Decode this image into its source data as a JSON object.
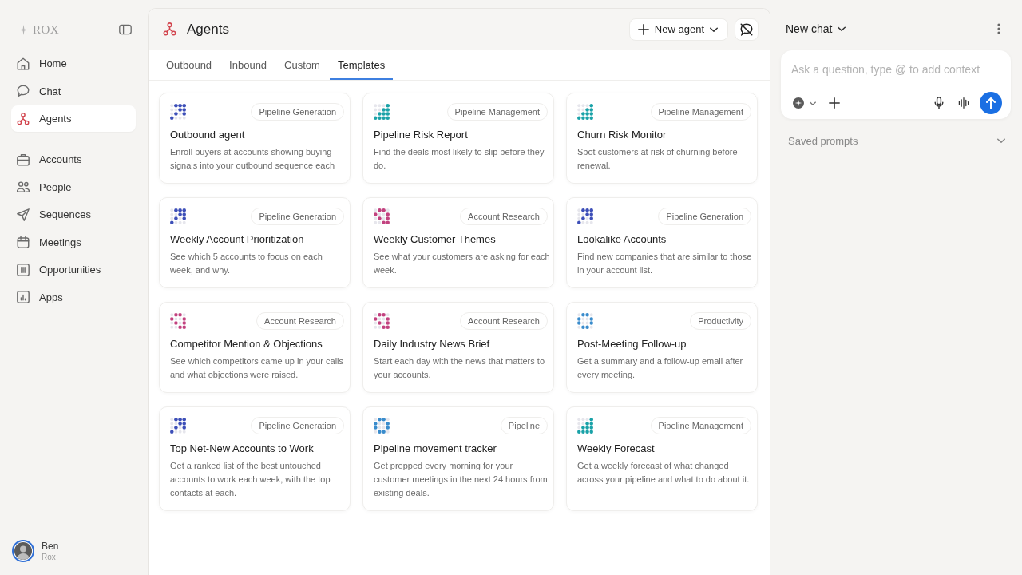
{
  "sidebar": {
    "logo": "ROX",
    "primary_nav": [
      {
        "label": "Home",
        "selected": false
      },
      {
        "label": "Chat",
        "selected": false
      },
      {
        "label": "Agents",
        "selected": true
      }
    ],
    "secondary_nav": [
      {
        "label": "Accounts",
        "selected": false
      },
      {
        "label": "People",
        "selected": false
      },
      {
        "label": "Sequences",
        "selected": false
      },
      {
        "label": "Meetings",
        "selected": false
      },
      {
        "label": "Opportunities",
        "selected": false
      },
      {
        "label": "Apps",
        "selected": false
      }
    ],
    "user": {
      "name": "Ben",
      "workspace": "Rox"
    }
  },
  "header": {
    "title": "Agents",
    "new_button": "New agent"
  },
  "tabs": [
    {
      "label": "Outbound",
      "selected": false
    },
    {
      "label": "Inbound",
      "selected": false
    },
    {
      "label": "Custom",
      "selected": false
    },
    {
      "label": "Templates",
      "selected": true
    }
  ],
  "cards": [
    {
      "tag": "Pipeline Generation",
      "title": "Outbound agent",
      "description": "Enroll buyers at accounts showing buying signals into your outbound sequence each",
      "color": "#3d4fb8"
    },
    {
      "tag": "Pipeline Management",
      "title": "Pipeline Risk Report",
      "description": "Find the deals most likely to slip before they do.",
      "color": "#1aa2a8"
    },
    {
      "tag": "Pipeline Management",
      "title": "Churn Risk Monitor",
      "description": "Spot customers at risk of churning before renewal.",
      "color": "#1aa2a8"
    },
    {
      "tag": "Pipeline Generation",
      "title": "Weekly Account Prioritization",
      "description": "See which 5 accounts to focus on each week, and why.",
      "color": "#3d4fb8"
    },
    {
      "tag": "Account Research",
      "title": "Weekly Customer Themes",
      "description": "See what your customers are asking for each week.",
      "color": "#c2427f"
    },
    {
      "tag": "Pipeline Generation",
      "title": "Lookalike Accounts",
      "description": "Find new companies that are similar to those in your account list.",
      "color": "#3d4fb8"
    },
    {
      "tag": "Account Research",
      "title": "Competitor Mention & Objections",
      "description": "See which competitors came up in your calls and what objections were raised.",
      "color": "#c2427f"
    },
    {
      "tag": "Account Research",
      "title": "Daily Industry News Brief",
      "description": "Start each day with the news that matters to your accounts.",
      "color": "#c2427f"
    },
    {
      "tag": "Productivity",
      "title": "Post-Meeting Follow-up",
      "description": "Get a summary and a follow-up email after every meeting.",
      "color": "#3a8ccc"
    },
    {
      "tag": "Pipeline Generation",
      "title": "Top Net-New Accounts to Work",
      "description": "Get a ranked list of the best untouched accounts to work each week, with the top contacts at each.",
      "color": "#3d4fb8"
    },
    {
      "tag": "Pipeline",
      "title": "Pipeline movement tracker",
      "description": "Get prepped every morning for your customer meetings in the next 24 hours from existing deals.",
      "color": "#3a8ccc"
    },
    {
      "tag": "Pipeline Management",
      "title": "Weekly Forecast",
      "description": "Get a weekly forecast of what changed across your pipeline and what to do about it.",
      "color": "#1aa2a8"
    }
  ],
  "chat": {
    "title": "New chat",
    "placeholder": "Ask a question, type @ to add context",
    "saved_prompts": "Saved prompts"
  }
}
